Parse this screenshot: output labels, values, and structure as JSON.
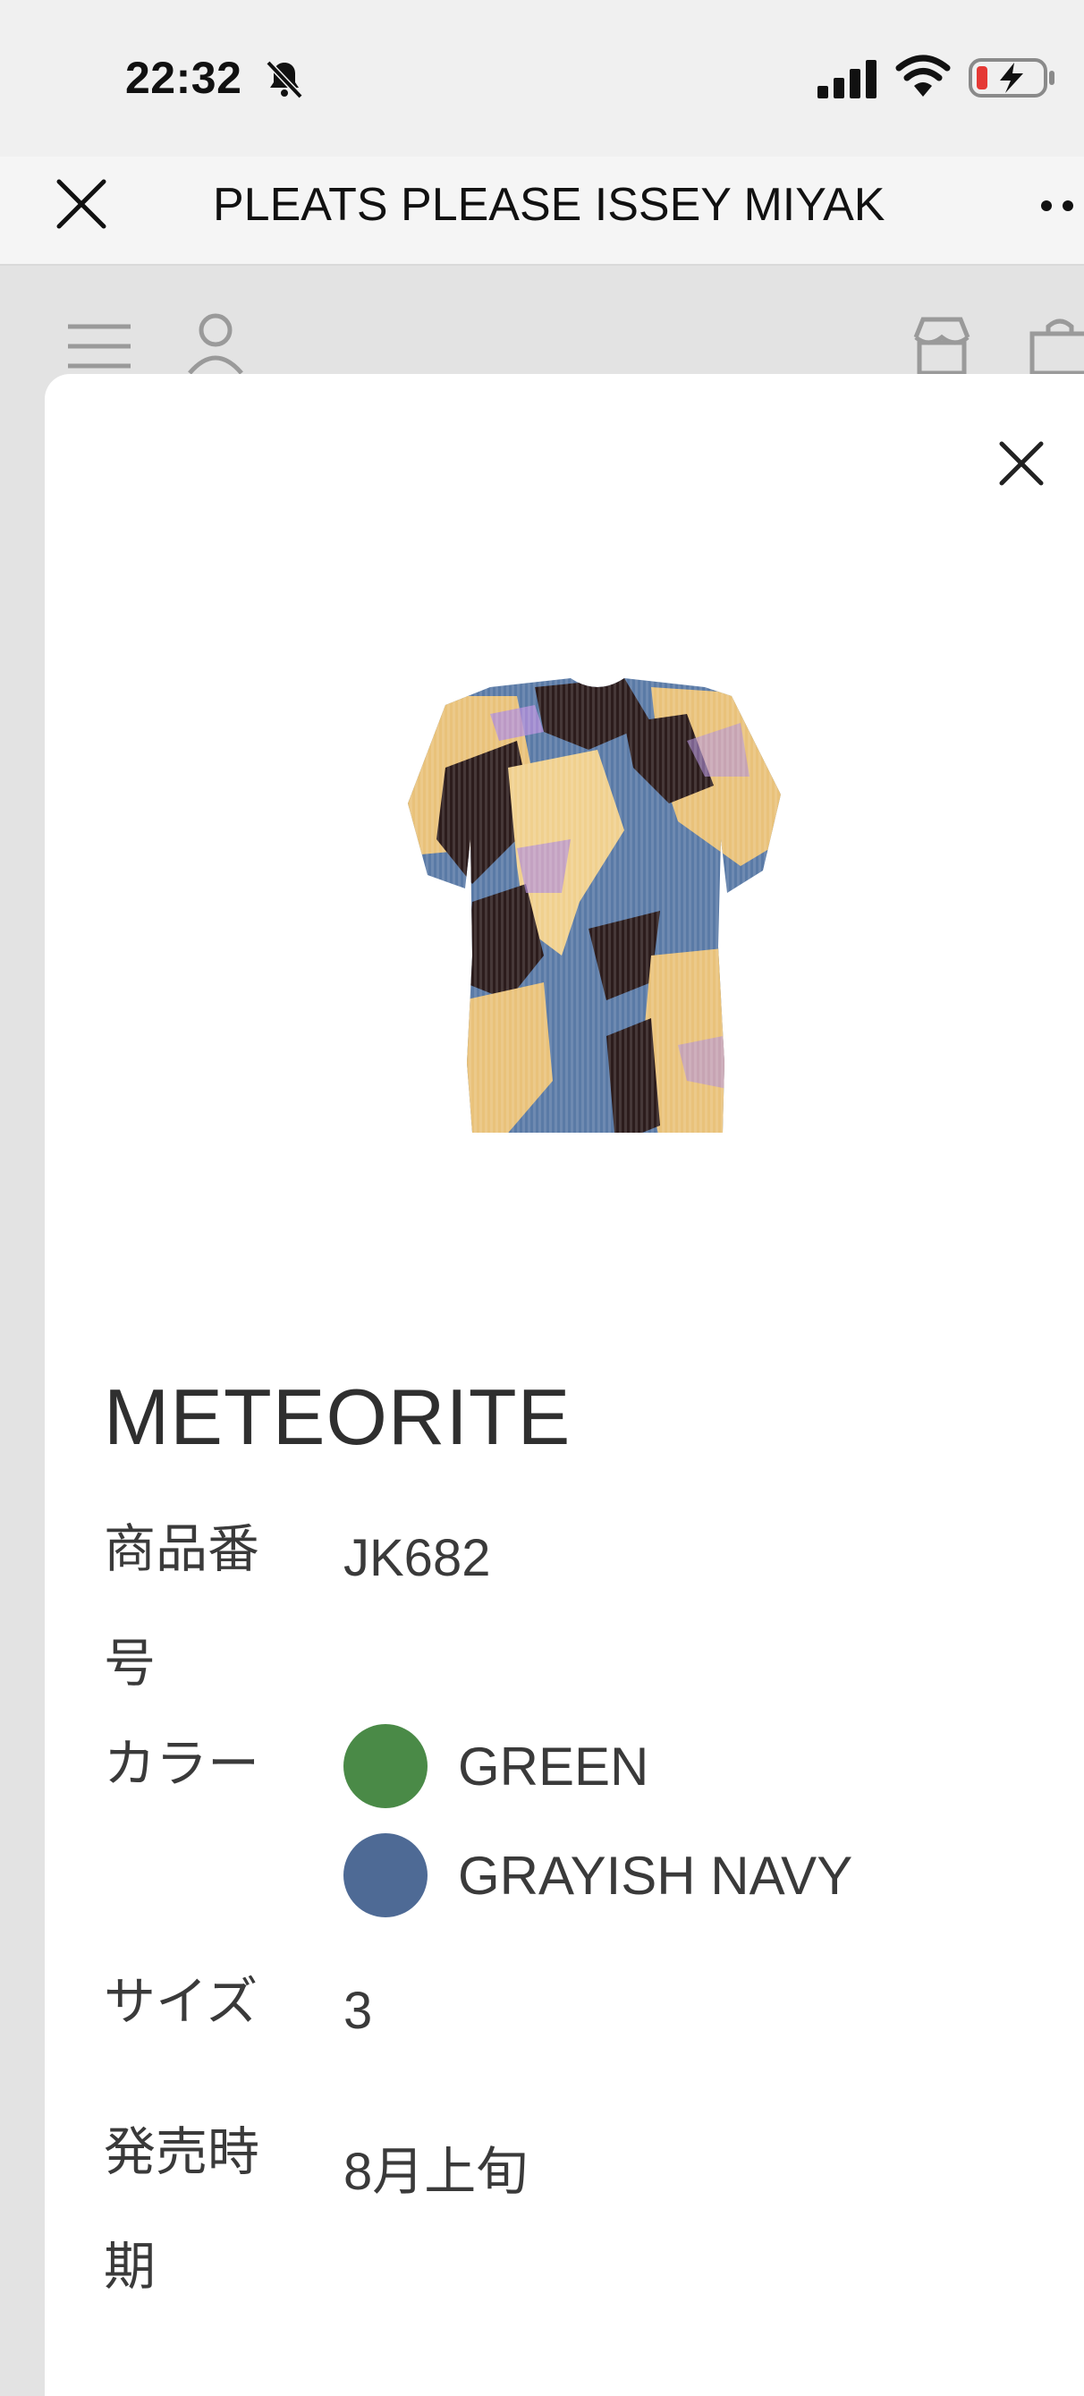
{
  "status_bar": {
    "time": "22:32",
    "icons": [
      "bell-slash-icon",
      "cellular-signal-icon",
      "wifi-icon",
      "battery-charging-icon"
    ]
  },
  "browser": {
    "title": "PLEATS PLEASE ISSEY MIYAK",
    "close_icon": "close-icon",
    "more_icon": "more-dots-icon"
  },
  "site_header": {
    "icons": [
      "menu-icon",
      "account-icon",
      "store-icon",
      "shopping-bag-icon"
    ]
  },
  "product": {
    "name": "METEORITE",
    "number_label": "商品番号",
    "number_value": "JK682",
    "color_label": "カラー",
    "colors": [
      {
        "name": "GREEN",
        "swatch": "#4a8a47"
      },
      {
        "name": "GRAYISH NAVY",
        "swatch": "#4e6a95"
      }
    ],
    "size_label": "サイズ",
    "size_value": "3",
    "release_label": "発売時期",
    "release_value": "8月上旬"
  },
  "colors": {
    "status_bg": "#f0f0f0",
    "overlay_bg": "#e3e3e3",
    "modal_bg": "#ffffff",
    "text": "#2f2f2f",
    "battery_low": "#e53935"
  }
}
